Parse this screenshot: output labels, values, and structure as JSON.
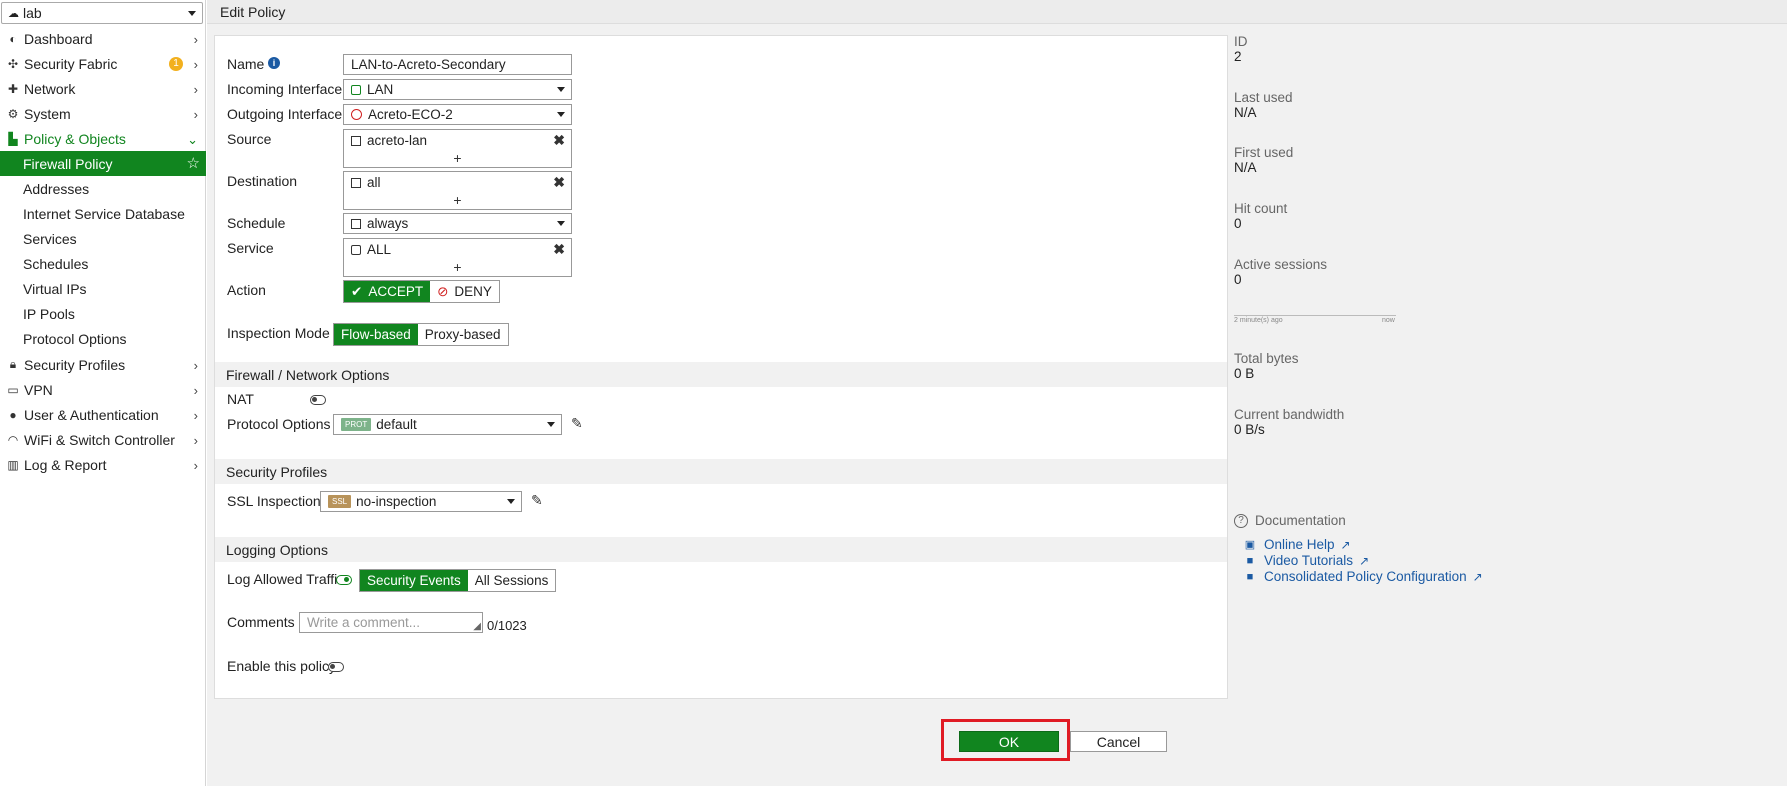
{
  "sidebar": {
    "vdom": "lab",
    "items": [
      {
        "label": "Dashboard",
        "icon": "dashboard-icon"
      },
      {
        "label": "Security Fabric",
        "icon": "fabric-icon",
        "badge": "1"
      },
      {
        "label": "Network",
        "icon": "network-icon"
      },
      {
        "label": "System",
        "icon": "gear-icon"
      },
      {
        "label": "Policy & Objects",
        "icon": "policy-icon"
      },
      {
        "label": "Security Profiles",
        "icon": "lock-icon"
      },
      {
        "label": "VPN",
        "icon": "laptop-icon"
      },
      {
        "label": "User & Authentication",
        "icon": "user-icon"
      },
      {
        "label": "WiFi & Switch Controller",
        "icon": "wifi-icon"
      },
      {
        "label": "Log & Report",
        "icon": "chart-icon"
      }
    ],
    "subitems": [
      "Firewall Policy",
      "Addresses",
      "Internet Service Database",
      "Services",
      "Schedules",
      "Virtual IPs",
      "IP Pools",
      "Protocol Options"
    ]
  },
  "header": {
    "title": "Edit Policy"
  },
  "form": {
    "name_label": "Name",
    "name_value": "LAN-to-Acreto-Secondary",
    "incoming_label": "Incoming Interface",
    "incoming_value": "LAN",
    "outgoing_label": "Outgoing Interface",
    "outgoing_value": "Acreto-ECO-2",
    "source_label": "Source",
    "source_value": "acreto-lan",
    "destination_label": "Destination",
    "destination_value": "all",
    "schedule_label": "Schedule",
    "schedule_value": "always",
    "service_label": "Service",
    "service_value": "ALL",
    "action_label": "Action",
    "accept_label": "ACCEPT",
    "deny_label": "DENY",
    "inspection_label": "Inspection Mode",
    "flow_label": "Flow-based",
    "proxy_label": "Proxy-based",
    "fw_section": "Firewall / Network Options",
    "nat_label": "NAT",
    "protocol_label": "Protocol Options",
    "protocol_tag": "PROT",
    "protocol_value": "default",
    "sec_section": "Security Profiles",
    "ssl_label": "SSL Inspection",
    "ssl_tag": "SSL",
    "ssl_value": "no-inspection",
    "log_section": "Logging Options",
    "log_label": "Log Allowed Traffic",
    "log_sec_events": "Security Events",
    "log_all_sessions": "All Sessions",
    "comments_label": "Comments",
    "comments_placeholder": "Write a comment...",
    "comments_count": "0/1023",
    "enable_label": "Enable this policy"
  },
  "stats": {
    "id_label": "ID",
    "id_value": "2",
    "last_used_label": "Last used",
    "last_used_value": "N/A",
    "first_used_label": "First used",
    "first_used_value": "N/A",
    "hit_count_label": "Hit count",
    "hit_count_value": "0",
    "active_sessions_label": "Active sessions",
    "active_sessions_value": "0",
    "spark_start": "2 minute(s) ago",
    "spark_end": "now",
    "total_bytes_label": "Total bytes",
    "total_bytes_value": "0 B",
    "bandwidth_label": "Current bandwidth",
    "bandwidth_value": "0 B/s"
  },
  "docs": {
    "title": "Documentation",
    "links": [
      "Online Help",
      "Video Tutorials",
      "Consolidated Policy Configuration"
    ]
  },
  "buttons": {
    "ok": "OK",
    "cancel": "Cancel"
  },
  "colors": {
    "accent": "#11851f",
    "highlight": "#e01b24",
    "link": "#1b5aa3"
  }
}
